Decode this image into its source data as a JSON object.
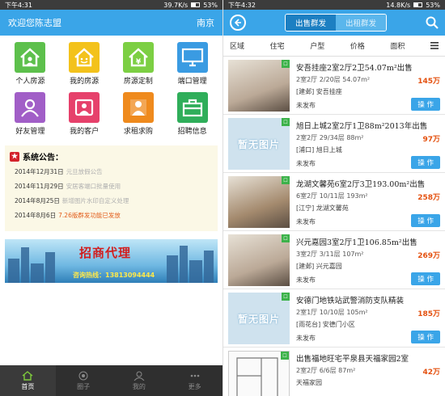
{
  "left": {
    "status": {
      "time": "下午4:31",
      "speed": "39.7K/s",
      "battery": "53%"
    },
    "header": {
      "title": "欢迎您陈志盟",
      "city": "南京"
    },
    "grid": [
      {
        "label": "个人房源",
        "color": "#5dc04c",
        "icon": "house-user-icon"
      },
      {
        "label": "我的房源",
        "color": "#f3c21b",
        "icon": "house-smile-icon"
      },
      {
        "label": "房源定制",
        "color": "#7ccf43",
        "icon": "house-money-icon"
      },
      {
        "label": "端口管理",
        "color": "#3a9be2",
        "icon": "monitor-icon"
      },
      {
        "label": "好友管理",
        "color": "#a15ec7",
        "icon": "friends-icon"
      },
      {
        "label": "我的客户",
        "color": "#e6416b",
        "icon": "customer-icon"
      },
      {
        "label": "求租求购",
        "color": "#ef8a1d",
        "icon": "person-search-icon"
      },
      {
        "label": "招聘信息",
        "color": "#2fae5a",
        "icon": "briefcase-icon"
      }
    ],
    "notice": {
      "title": "系统公告：",
      "rows": [
        {
          "date": "2014年12月31日",
          "text": "元旦放假公告"
        },
        {
          "date": "2014年11月29日",
          "text": "安居客端口批量使用"
        },
        {
          "date": "2014年8月25日",
          "text": "新增图片水印自定义处理"
        },
        {
          "date": "2014年8月6日",
          "text": "7.26版群发功能已发放"
        }
      ]
    },
    "banner": {
      "title": "招商代理",
      "phone": "咨询热线：13813094444"
    },
    "tabs": [
      "首页",
      "圈子",
      "我的",
      "更多"
    ]
  },
  "right": {
    "status": {
      "time": "下午4:32",
      "speed": "14.8K/s",
      "battery": "53%"
    },
    "segments": {
      "active": "出售群发",
      "inactive": "出租群发"
    },
    "filters": [
      "区域",
      "住宅",
      "户型",
      "价格",
      "面积"
    ],
    "op_label": "操 作",
    "items": [
      {
        "title": "安吾挂座2室2厅2卫54.07m²出售",
        "meta": "2室2厅  2/20层  54.07m²",
        "price": "145万",
        "addr": "[建邺] 安吾挂座",
        "status": "未发布",
        "img": "photo"
      },
      {
        "title": "旭日上城2室2厅1卫88m²2013年出售",
        "meta": "2室2厅  29/34层  88m²",
        "price": "97万",
        "addr": "[浦口] 旭日上城",
        "status": "未发布",
        "img": "none"
      },
      {
        "title": "龙湖文馨苑6室2厅3卫193.00m²出售",
        "meta": "6室2厅  10/11层  193m²",
        "price": "258万",
        "addr": "[江宁] 龙湖文馨苑",
        "status": "未发布",
        "img": "photo"
      },
      {
        "title": "兴元嘉园3室2厅1卫106.85m²出售",
        "meta": "3室2厅  3/11层  107m²",
        "price": "269万",
        "addr": "[建邺] 兴元嘉园",
        "status": "未发布",
        "img": "photo"
      },
      {
        "title": "安德门地铁站武警消防支队精装",
        "meta": "2室1厅  10/10层  105m²",
        "price": "185万",
        "addr": "[雨花台] 安德门小区",
        "status": "未发布",
        "img": "none"
      },
      {
        "title": "出售福地旺宅平泉县天福家园2室",
        "meta": "2室2厅  6/6层  87m²",
        "price": "42万",
        "addr": "天福家园",
        "status": "",
        "img": "plan"
      }
    ],
    "no_image_label": "暂无图片"
  }
}
